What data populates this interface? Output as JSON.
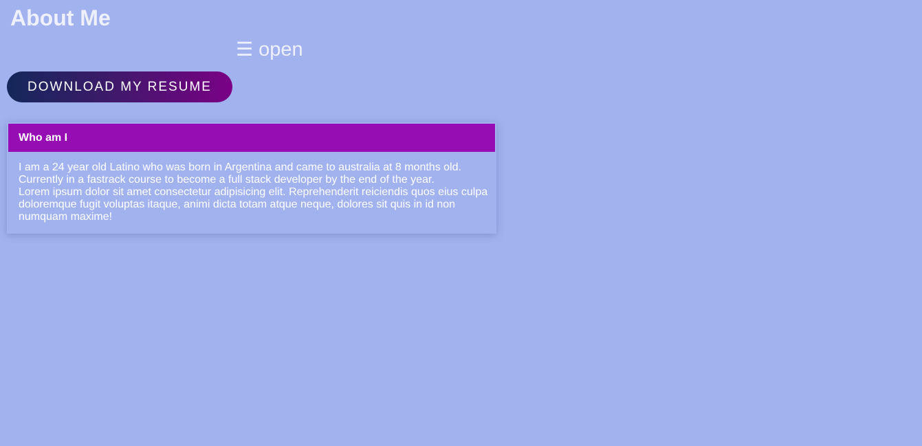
{
  "header": {
    "title": "About Me"
  },
  "menu": {
    "icon": "☰",
    "label": "open"
  },
  "resume": {
    "label": "DOWNLOAD MY RESUME"
  },
  "card": {
    "title": "Who am I",
    "paragraphs": [
      "I am a 24 year old Latino who was born in Argentina and came to australia at 8 months old. Currently in a fastrack course to become a full stack developer by the end of the year.",
      "Lorem ipsum dolor sit amet consectetur adipisicing elit. Reprehenderit reiciendis quos eius culpa doloremque fugit voluptas itaque, animi dicta totam atque neque, dolores sit quis in id non numquam maxime!"
    ]
  },
  "colors": {
    "background": "#a2b2ee",
    "card_header": "#960db4",
    "button_gradient_start": "#14275a",
    "button_gradient_end": "#7a0085"
  }
}
